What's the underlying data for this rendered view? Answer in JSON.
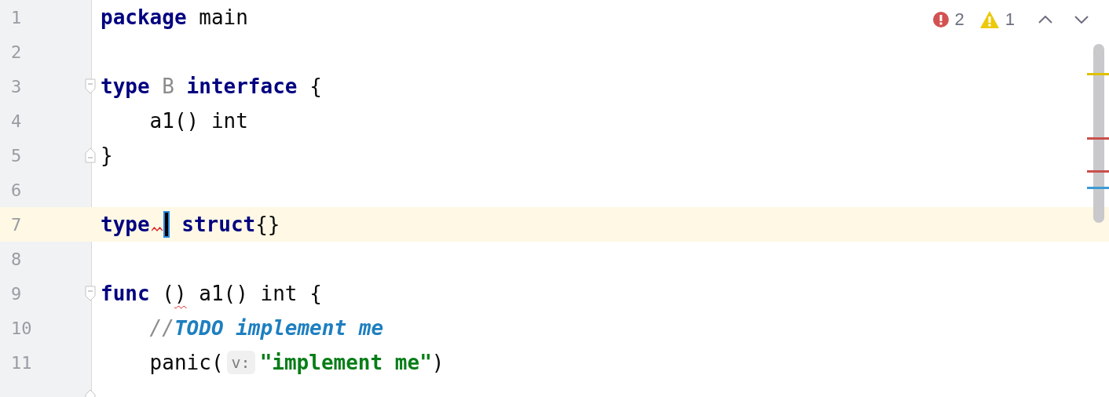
{
  "inspections": {
    "errors": "2",
    "warnings": "1"
  },
  "lines": [
    {
      "number": "1",
      "current": false,
      "fold_start": false,
      "fold_end": false,
      "tokens": [
        {
          "kind": "keyword",
          "text": "package"
        },
        {
          "kind": "plain",
          "text": " main"
        }
      ]
    },
    {
      "number": "2",
      "current": false,
      "fold_start": false,
      "fold_end": false
    },
    {
      "number": "3",
      "current": false,
      "fold_start": true,
      "fold_end": false,
      "tokens": [
        {
          "kind": "keyword",
          "text": "type"
        },
        {
          "kind": "unused",
          "text": " B"
        },
        {
          "kind": "keyword",
          "text": " interface"
        },
        {
          "kind": "plain",
          "text": " {"
        }
      ]
    },
    {
      "number": "4",
      "current": false,
      "fold_start": false,
      "fold_end": false,
      "tokens": [
        {
          "kind": "plain",
          "text": "    a1() int"
        }
      ]
    },
    {
      "number": "5",
      "current": false,
      "fold_start": false,
      "fold_end": true,
      "tokens": [
        {
          "kind": "plain",
          "text": "}"
        }
      ]
    },
    {
      "number": "6",
      "current": false,
      "fold_start": false,
      "fold_end": false
    },
    {
      "number": "7",
      "current": true,
      "fold_start": false,
      "fold_end": false,
      "tokens": [
        {
          "kind": "keyword",
          "text": "type",
          "error_after": true
        },
        {
          "kind": "caret"
        },
        {
          "kind": "keyword",
          "text": " struct"
        },
        {
          "kind": "plain",
          "text": "{}"
        }
      ]
    },
    {
      "number": "8",
      "current": false,
      "fold_start": false,
      "fold_end": false
    },
    {
      "number": "9",
      "current": false,
      "fold_start": true,
      "fold_end": false,
      "tokens": [
        {
          "kind": "keyword",
          "text": "func"
        },
        {
          "kind": "plain",
          "text": " ("
        },
        {
          "kind": "plain",
          "text": ")",
          "error": true
        },
        {
          "kind": "plain",
          "text": " a1() int {"
        }
      ]
    },
    {
      "number": "10",
      "current": false,
      "fold_start": false,
      "fold_end": false,
      "tokens": [
        {
          "kind": "comment",
          "text": "    //"
        },
        {
          "kind": "todo",
          "text": "TODO implement me"
        }
      ]
    },
    {
      "number": "11",
      "current": false,
      "fold_start": false,
      "fold_end": false,
      "tokens": [
        {
          "kind": "plain",
          "text": "    panic("
        },
        {
          "kind": "hint",
          "text": "v:"
        },
        {
          "kind": "string",
          "text": "\"implement me\""
        },
        {
          "kind": "plain",
          "text": ")"
        }
      ]
    },
    {
      "current": false,
      "fold_start": false,
      "fold_end": true
    }
  ],
  "stripe_marks": [
    {
      "color": "#e0c000"
    },
    {
      "color": "#c9504c"
    },
    {
      "color": "#c9504c"
    },
    {
      "color": "#3d9ad6"
    }
  ]
}
